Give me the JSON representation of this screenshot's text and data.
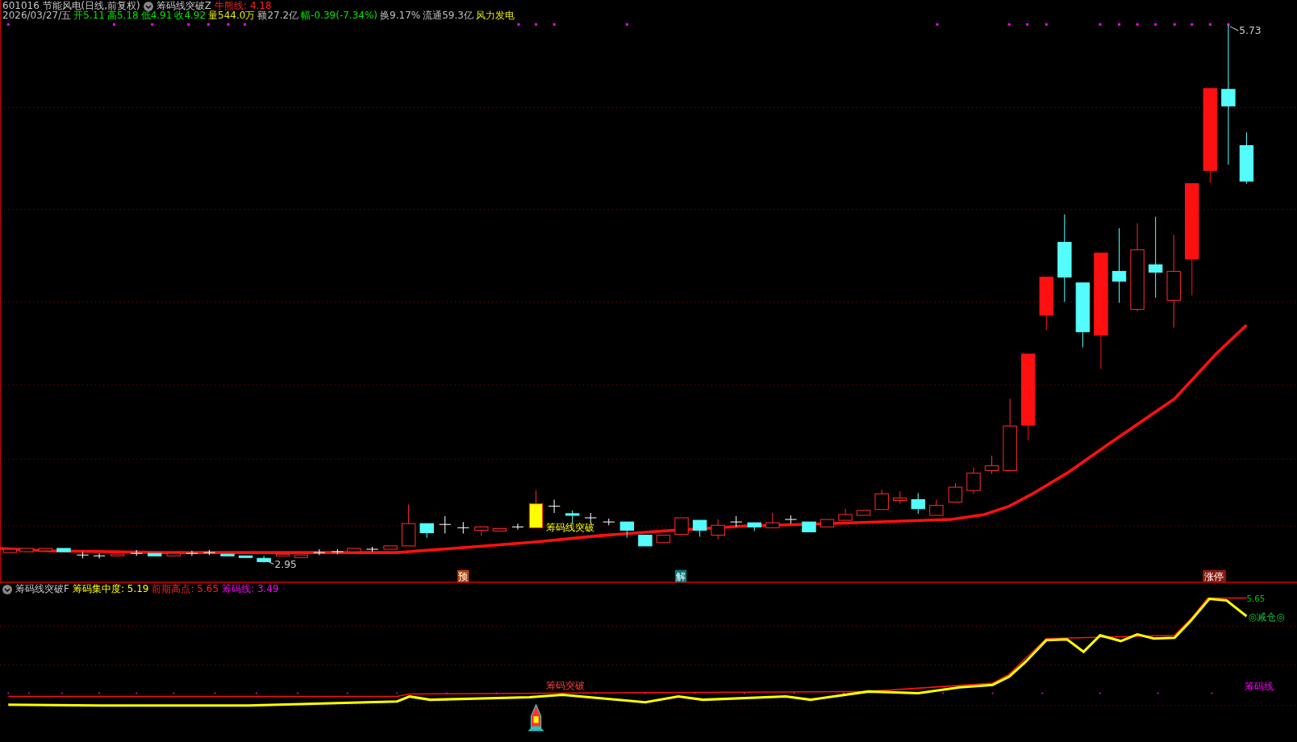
{
  "title_bar": {
    "security": "601016 节能风电(日线,前复权)",
    "indicator": "筹码线突破Z",
    "values": [
      {
        "text": "牛熊线: 4.18",
        "color": "#ff2020"
      }
    ]
  },
  "quote_bar": [
    {
      "text": "2026/03/27/五",
      "color": "#c0c0c0"
    },
    {
      "text": "开5.11",
      "color": "#00e600"
    },
    {
      "text": "高5.18",
      "color": "#00e600"
    },
    {
      "text": "低4.91",
      "color": "#00e600"
    },
    {
      "text": "收4.92",
      "color": "#00e600"
    },
    {
      "text": "量544.0万",
      "color": "#e6e600"
    },
    {
      "text": "额27.2亿",
      "color": "#c0c0c0"
    },
    {
      "text": "幅-0.39(-7.34%)",
      "color": "#00e600"
    },
    {
      "text": "换9.17%",
      "color": "#c0c0c0"
    },
    {
      "text": "流通59.3亿",
      "color": "#c0c0c0"
    },
    {
      "text": "风力发电",
      "color": "#e6e600"
    }
  ],
  "main_chart": {
    "high_label": "5.73",
    "low_label": "2.95",
    "signal_label": "筹码线突破",
    "markers": [
      {
        "text": "预",
        "color": "#b04000"
      },
      {
        "text": "解",
        "color": "#007a7a"
      },
      {
        "text": "涨停",
        "color": "#8a1a10"
      }
    ]
  },
  "indicator_panel": {
    "name": "筹码线突破F",
    "values": [
      {
        "text": "筹码集中度: 5.19",
        "color": "#ffff00"
      },
      {
        "text": "前期高点: 5.65",
        "color": "#ff2020"
      },
      {
        "text": "筹码线: 3.49",
        "color": "#ff00ff"
      }
    ],
    "level_label": "5.65",
    "action_label": "◎减仓◎",
    "line_label": "筹码线",
    "signal_label": "筹码突破"
  }
}
